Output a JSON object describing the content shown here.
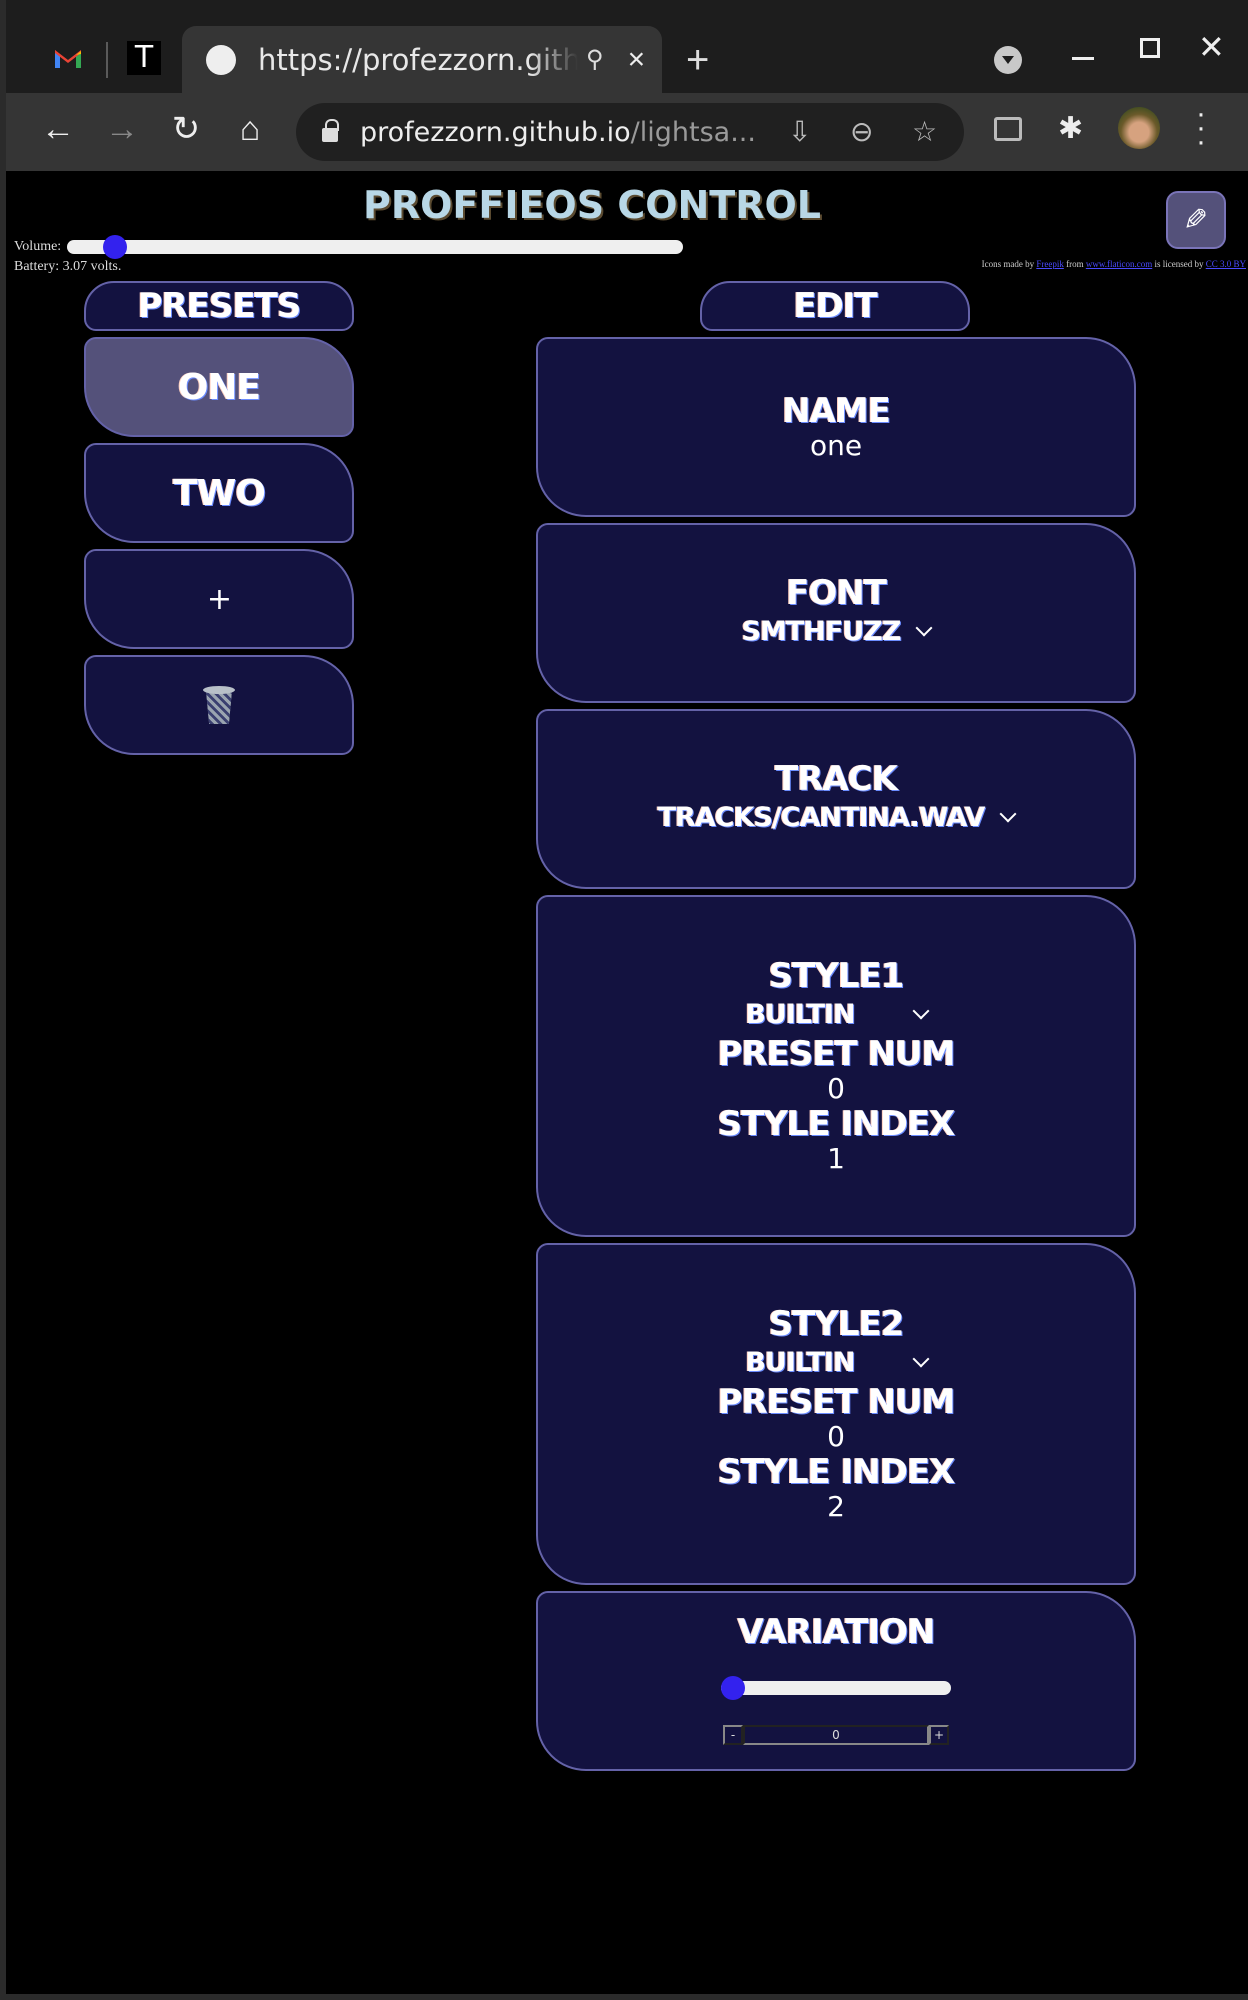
{
  "browser": {
    "pinned_tabs": [
      {
        "name": "gmail",
        "icon": "gmail-icon"
      },
      {
        "name": "t-site",
        "icon": "t-logo-icon"
      }
    ],
    "active_tab": {
      "title": "https://profezzorn.github.io/lightsaber-web-bluetooth/",
      "icon": "globe-icon"
    },
    "new_tab_label": "+",
    "address": {
      "domain": "profezzorn.github.io",
      "path": "/lightsa..."
    }
  },
  "page": {
    "title": "ProffieOS Control",
    "edit_toggle_icon": "✎",
    "volume_label": "Volume:",
    "volume_fraction": 0.06,
    "battery_text": "Battery: 3.07 volts.",
    "credits": {
      "prefix": "Icons made by ",
      "author": "Freepik",
      "middle": " from ",
      "site": "www.flaticon.com",
      "license_prefix": " is licensed by ",
      "license": "CC 3.0 BY"
    }
  },
  "presets": {
    "header": "Presets",
    "items": [
      {
        "label": "one",
        "active": true
      },
      {
        "label": "two",
        "active": false
      }
    ],
    "add_label": "+",
    "delete_icon": "trash-icon"
  },
  "edit": {
    "header": "Edit",
    "name": {
      "label": "Name",
      "value": "one"
    },
    "font": {
      "label": "Font",
      "value": "smthfuzz"
    },
    "track": {
      "label": "Track",
      "value": "tracks/cantina.wav"
    },
    "style1": {
      "label": "Style1",
      "type": "builtin",
      "preset_num_label": "Preset Num",
      "preset_num": "0",
      "style_index_label": "Style Index",
      "style_index": "1"
    },
    "style2": {
      "label": "Style2",
      "type": "builtin",
      "preset_num_label": "Preset Num",
      "preset_num": "0",
      "style_index_label": "Style Index",
      "style_index": "2"
    },
    "variation": {
      "label": "Variation",
      "slider_fraction": 0,
      "value": "0",
      "minus_label": "-",
      "plus_label": "+"
    }
  }
}
